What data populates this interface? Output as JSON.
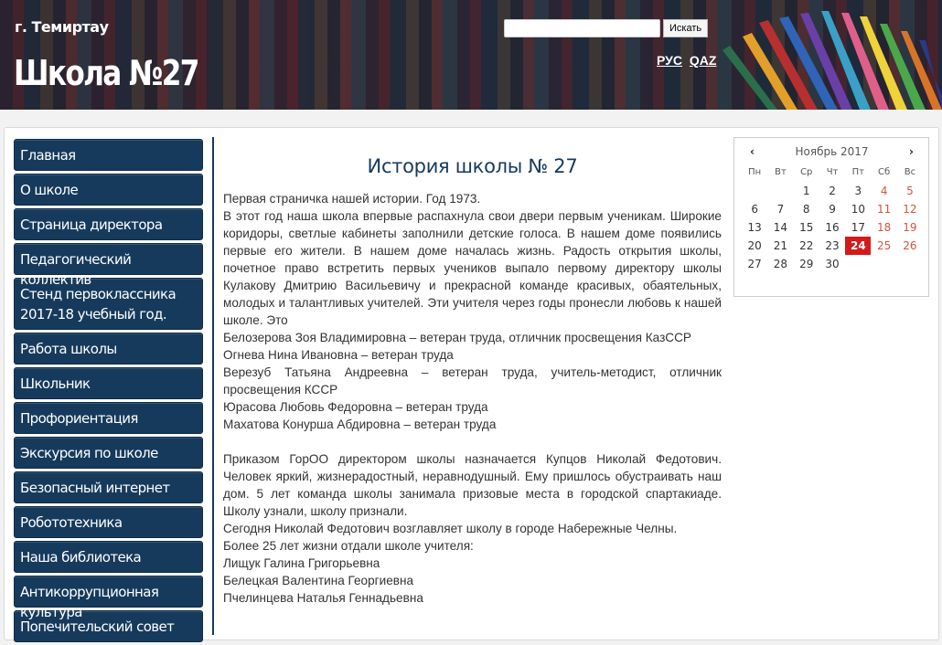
{
  "header": {
    "city": "г. Темиртау",
    "title": "Школа №27",
    "search_placeholder": "",
    "search_button": "Искать",
    "lang_ru": "РУС",
    "lang_kz": "QAZ"
  },
  "nav": [
    {
      "label": "Главная"
    },
    {
      "label": "О школе"
    },
    {
      "label": "Страница директора"
    },
    {
      "label": "Педагогический коллектив"
    },
    {
      "label": "Стенд первоклассника 2017-18 учебный год."
    },
    {
      "label": "Работа школы"
    },
    {
      "label": "Школьник"
    },
    {
      "label": "Профориентация"
    },
    {
      "label": "Экскурсия по школе"
    },
    {
      "label": "Безопасный интернет"
    },
    {
      "label": "Робототехника"
    },
    {
      "label": "Наша библиотека"
    },
    {
      "label": "Антикоррупционная культура"
    },
    {
      "label": "Попечительский совет"
    }
  ],
  "article": {
    "title": "История школы № 27",
    "p1": "Первая страничка нашей истории. Год 1973.",
    "p2": "В этот год наша школа впервые распахнула свои двери первым ученикам. Широкие коридоры, светлые кабинеты заполнили детские голоса. В нашем доме появились первые его жители. В нашем доме началась жизнь. Радость открытия школы, почетное право встретить первых учеников выпало первому директору школы Кулакову Дмитрию Васильевичу и прекрасной команде красивых, обаятельных, молодых и талантливых учителей. Эти учителя через годы пронесли любовь к нашей школе. Это",
    "p3": "Белозерова Зоя Владимировна – ветеран труда, отличник просвещения КазССР",
    "p4": "Огнева Нина Ивановна – ветеран труда",
    "p5": "Верезуб Татьяна Андреевна – ветеран труда, учитель-методист, отличник просвещения КССР",
    "p6": "Юрасова Любовь Федоровна – ветеран труда",
    "p7": "Махатова Конурша Абдировна – ветеран труда",
    "p8": "Приказом ГорОО директором школы назначается Купцов Николай Федотович. Человек яркий, жизнерадостный, неравнодушный. Ему пришлось обустраивать наш дом. 5 лет команда школы занимала призовые места в городской спартакиаде. Школу узнали, школу признали.",
    "p9": "Сегодня Николай Федотович возглавляет школу в городе Набережные Челны.",
    "p10": "Более 25 лет жизни отдали школе учителя:",
    "p11": "Лищук Галина Григорьевна",
    "p12": "Белецкая Валентина Георгиевна",
    "p13": "Пчелинцева Наталья Геннадьевна"
  },
  "calendar": {
    "prev": "‹",
    "next": "›",
    "month": "Ноябрь 2017",
    "weekdays": [
      "Пн",
      "Вт",
      "Ср",
      "Чт",
      "Пт",
      "Сб",
      "Вс"
    ],
    "weeks": [
      [
        "",
        "",
        "1",
        "2",
        "3",
        "4",
        "5"
      ],
      [
        "6",
        "7",
        "8",
        "9",
        "10",
        "11",
        "12"
      ],
      [
        "13",
        "14",
        "15",
        "16",
        "17",
        "18",
        "19"
      ],
      [
        "20",
        "21",
        "22",
        "23",
        "24",
        "25",
        "26"
      ],
      [
        "27",
        "28",
        "29",
        "30",
        "",
        "",
        ""
      ]
    ],
    "today": "24"
  }
}
